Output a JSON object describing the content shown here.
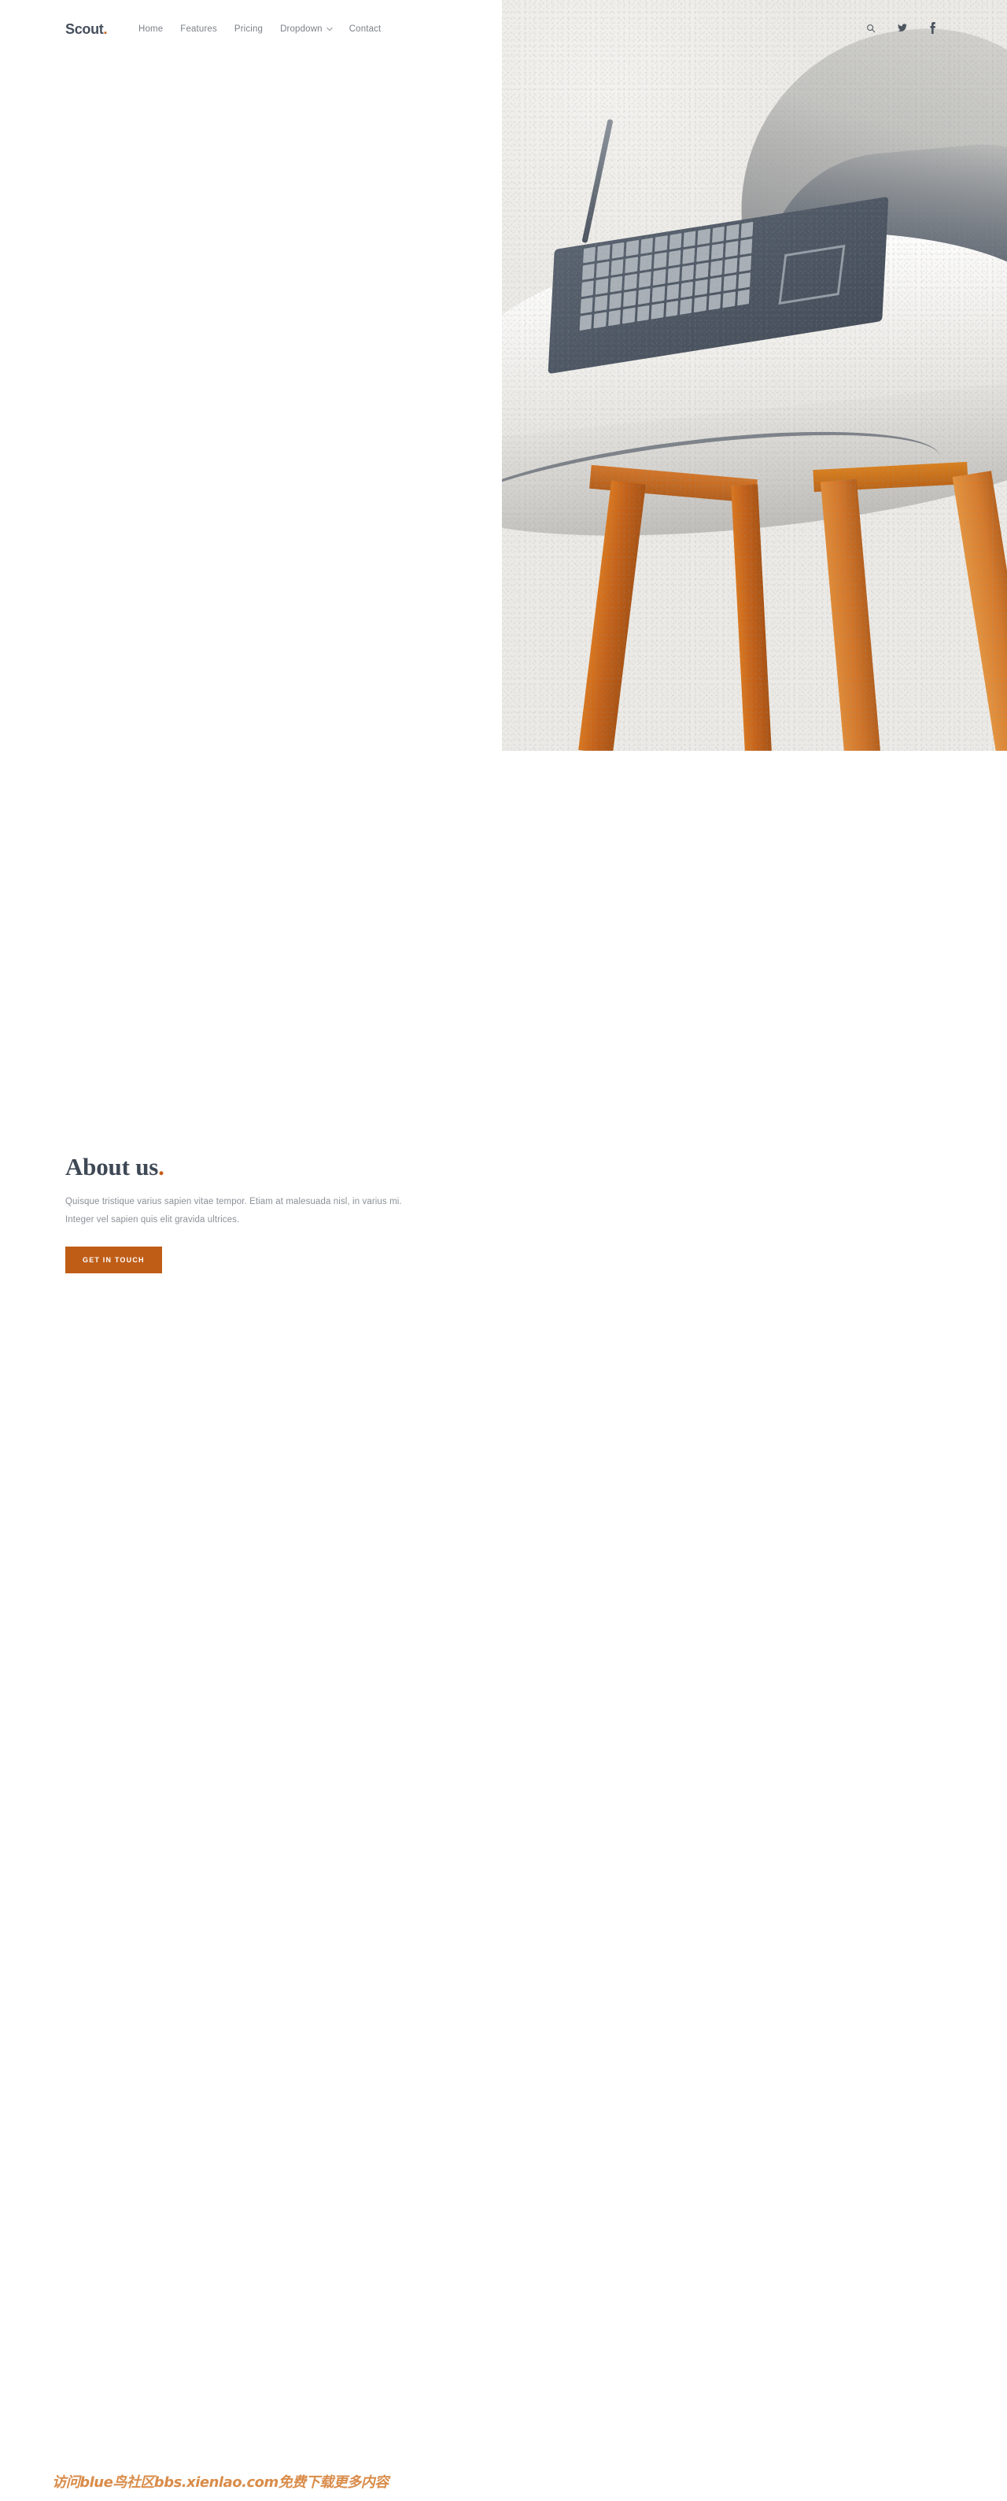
{
  "header": {
    "logo_text": "Scout",
    "logo_dot": ".",
    "nav": [
      {
        "label": "Home"
      },
      {
        "label": "Features"
      },
      {
        "label": "Pricing"
      },
      {
        "label": "Dropdown",
        "icon": "chevron-down-icon",
        "has_chevron": true
      },
      {
        "label": "Contact"
      }
    ],
    "social": [
      {
        "name": "search-icon"
      },
      {
        "name": "twitter-icon"
      },
      {
        "name": "facebook-icon"
      }
    ]
  },
  "hero": {
    "image_alt": "laptop on white chair with orange wooden legs"
  },
  "about": {
    "heading": "About us",
    "heading_dot": ".",
    "paragraph": "Quisque tristique varius sapien vitae tempor. Etiam at malesuada nisl, in varius mi. Integer vel sapien quis elit gravida ultrices.",
    "cta_label": "GET IN TOUCH"
  },
  "watermark": {
    "text": "访问blue鸟社区bbs.xienlao.com免费下载更多内容"
  },
  "colors": {
    "accent": "#c65f1b",
    "button": "#bf5d17",
    "heading": "#3f4855",
    "body_text": "#8b9096",
    "nav_text": "#7c8187",
    "hero_bg": "#edece8",
    "watermark": "#d98c4a"
  }
}
